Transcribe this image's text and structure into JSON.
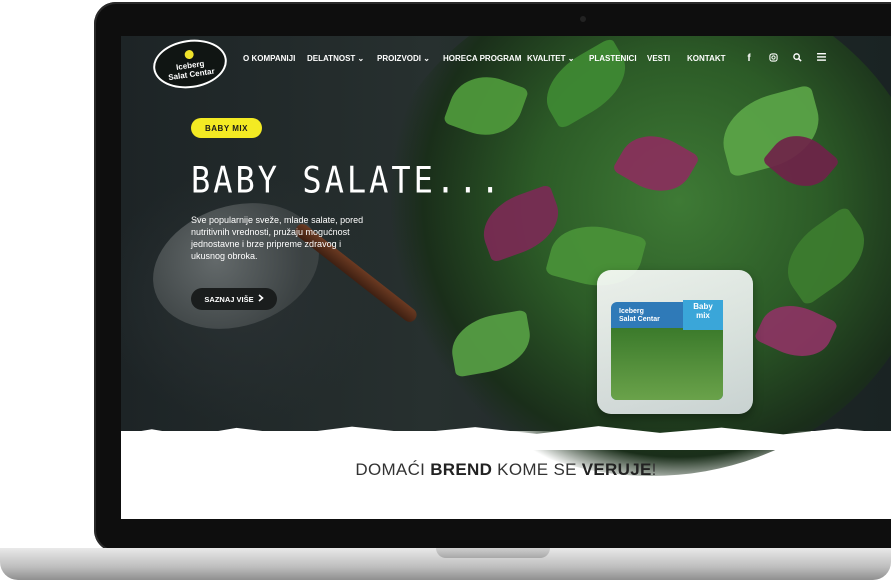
{
  "nav": {
    "logo_line1": "Iceberg",
    "logo_line2": "Salat Centar",
    "items": [
      "O KOMPANIJI",
      "DELATNOST ⌄",
      "PROIZVODI ⌄",
      "HORECA PROGRAM",
      "KVALITET ⌄",
      "PLASTENICI",
      "VESTI",
      "KONTAKT"
    ],
    "icons": [
      "facebook-icon",
      "instagram-icon",
      "search-icon",
      "menu-icon"
    ]
  },
  "hero": {
    "badge": "BABY MIX",
    "title": "BABY SALATE...",
    "description": "Sve popularnije sveže, mlade salate, pored nutritivnih vrednosti, pružaju mogućnost jednostavne i brze pripreme zdravog i ukusnog obroka.",
    "cta_label": "SAZNAJ VIŠE"
  },
  "product": {
    "brand_line1": "Iceberg",
    "brand_line2": "Salat Centar",
    "name_line1": "Baby",
    "name_line2": "mix"
  },
  "tagline": {
    "part1": "DOMAĆI ",
    "bold1": "BREND",
    "part2": " KOME SE ",
    "bold2": "VERUJE",
    "part3": "!"
  },
  "colors": {
    "accent_yellow": "#f3ea23",
    "dark": "#1a1d1d"
  }
}
